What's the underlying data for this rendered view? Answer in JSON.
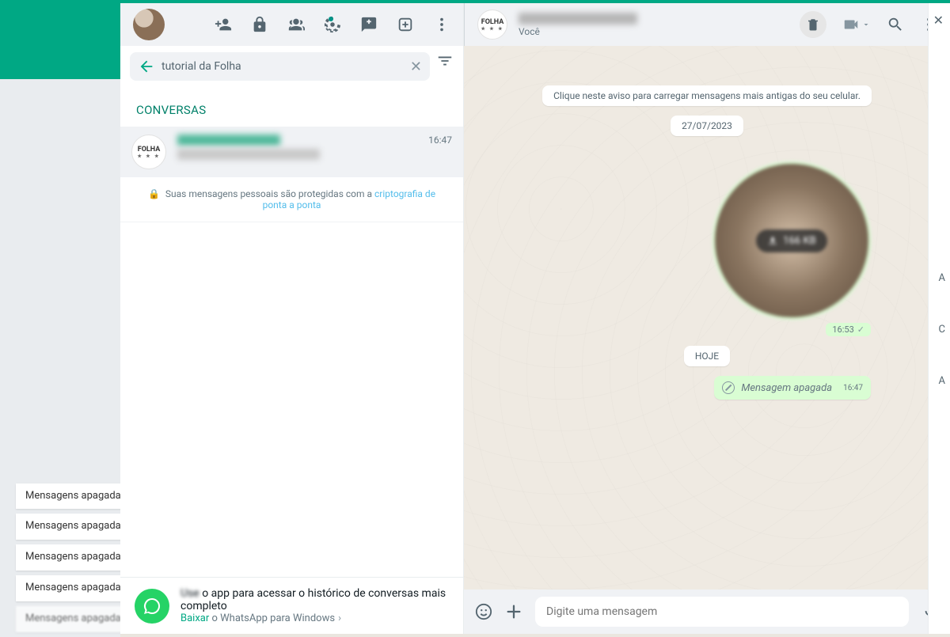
{
  "search": {
    "value": "tutorial da Folha"
  },
  "section_label": "CONVERSAS",
  "chat_item": {
    "time": "16:47"
  },
  "e2e": {
    "prefix": "Suas mensagens pessoais são protegidas com a ",
    "link": "criptografia de ponta a ponta"
  },
  "banner": {
    "line1a": "Use ",
    "line1b": "o app para acessar o histórico de conversas mais ",
    "line1c": "completo",
    "sub_link": "Baixar",
    "sub_rest": " o WhatsApp para Windows"
  },
  "toasts": [
    "Mensagens apagadas restauradas",
    "Mensagens apagadas restauradas",
    "Mensagens apagadas restauradas",
    "Mensagens apagadas restauradas",
    "Mensagens apagadas restauradas"
  ],
  "chat_header": {
    "sub": "Você"
  },
  "messages": {
    "load_more": "Clique neste aviso para carregar mensagens mais antigas do seu celular.",
    "date1": "27/07/2023",
    "media_size": "166 KB",
    "media_time": "16:53",
    "date2": "HOJE",
    "deleted_text": "Mensagem apagada",
    "deleted_time": "16:47"
  },
  "input": {
    "placeholder": "Digite uma mensagem"
  },
  "folha": "FOLHA",
  "sliver": [
    "A",
    "C",
    "A"
  ]
}
